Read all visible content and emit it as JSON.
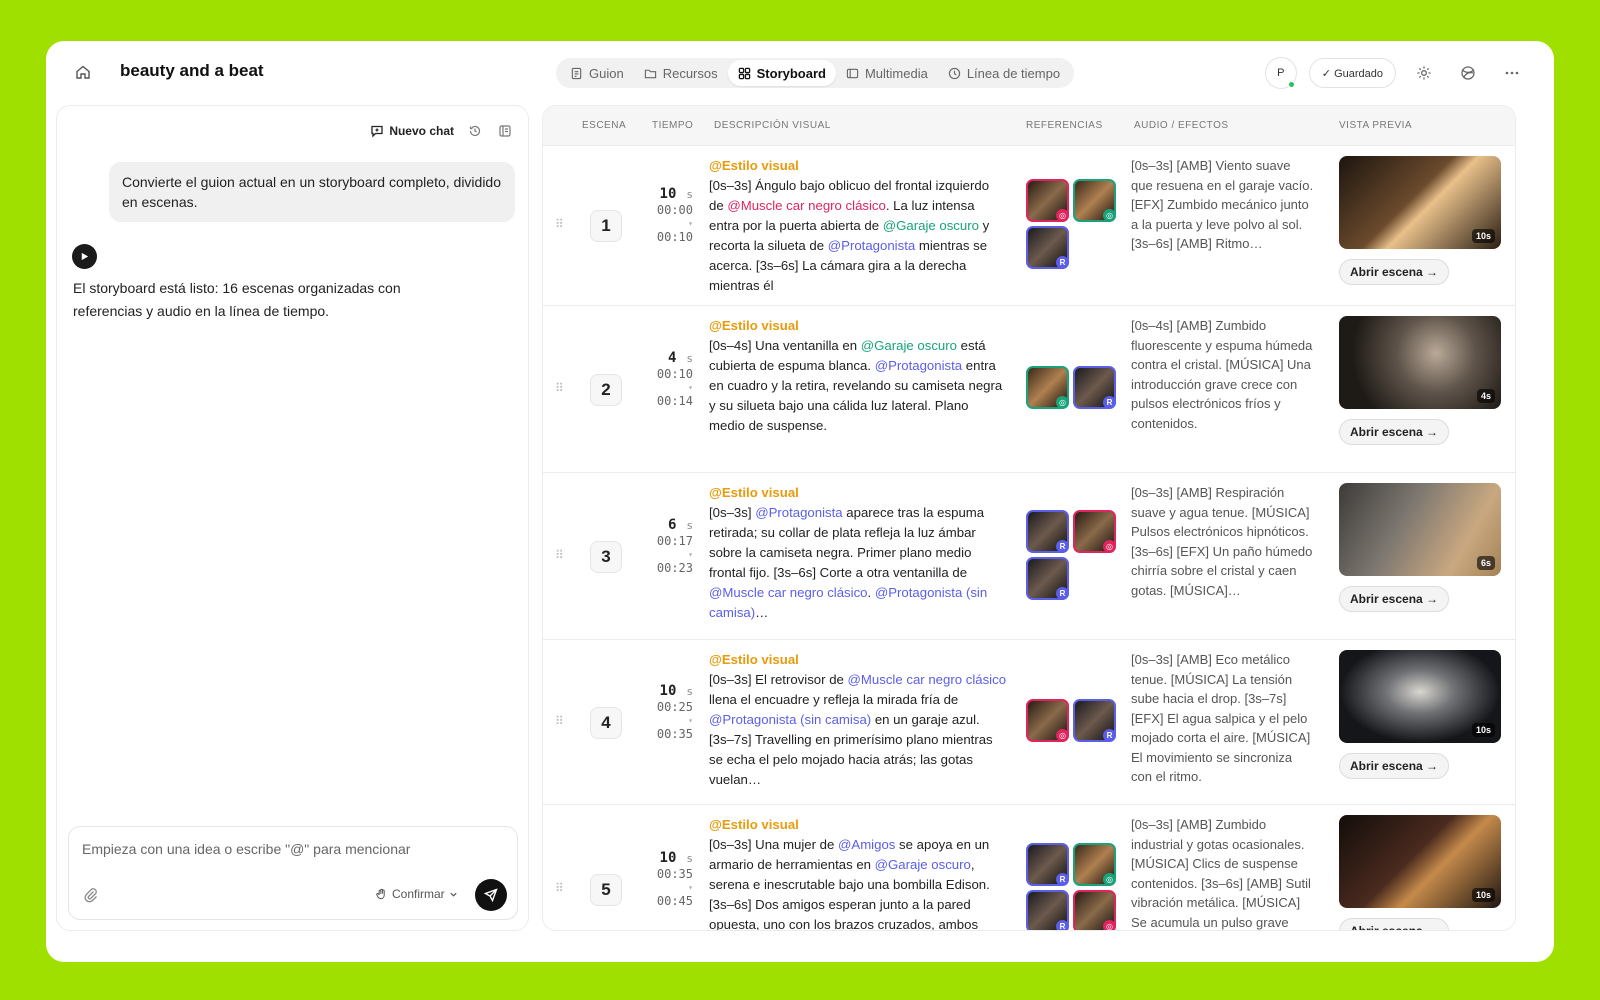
{
  "header": {
    "title": "beauty and a beat",
    "tabs": [
      {
        "label": "Guion",
        "icon": "script-icon"
      },
      {
        "label": "Recursos",
        "icon": "folder-icon"
      },
      {
        "label": "Storyboard",
        "icon": "grid-icon",
        "active": true
      },
      {
        "label": "Multimedia",
        "icon": "media-icon"
      },
      {
        "label": "Línea de tiempo",
        "icon": "clock-icon"
      }
    ],
    "avatar_initial": "P",
    "saved_label": "✓ Guardado"
  },
  "chat": {
    "new_chat_label": "Nuevo chat",
    "user_message": "Convierte el guion actual en un storyboard completo, dividido en escenas.",
    "ai_message": "El storyboard está listo: 16 escenas organizadas con referencias y audio en la línea de tiempo.",
    "composer_placeholder": "Empieza con una idea o escribe \"@\" para mencionar",
    "confirm_label": "Confirmar"
  },
  "table": {
    "columns": {
      "escena": "ESCENA",
      "tiempo": "TIEMPO",
      "descripcion": "DESCRIPCIÓN VISUAL",
      "referencias": "REFERENCIAS",
      "audio": "AUDIO / EFECTOS",
      "vista": "VISTA PREVIA"
    },
    "open_label": "Abrir escena →",
    "style_tag": "@Estilo visual",
    "scenes": [
      {
        "number": "1",
        "duration": "10",
        "unit": "s",
        "start": "00:00",
        "end": "00:10",
        "desc": [
          {
            "t": "[0s–3s] Ángulo bajo oblicuo del frontal izquierdo de "
          },
          {
            "t": "@Muscle car negro clásico",
            "c": "red"
          },
          {
            "t": ". La luz intensa entra por la puerta abierta de "
          },
          {
            "t": "@Garaje oscuro",
            "c": "green"
          },
          {
            "t": " y recorta la silueta de "
          },
          {
            "t": "@Protagonista",
            "c": "blue"
          },
          {
            "t": " mientras se acerca. [3s–6s] La cámara gira a la derecha mientras él"
          }
        ],
        "refs": [
          "red",
          "green",
          "blue"
        ],
        "audio": "[0s–3s] [AMB] Viento suave que resuena en el garaje vacío. [EFX] Zumbido mecánico junto a la puerta y leve polvo al sol. [3s–6s] [AMB] Ritmo…",
        "preview_dur": "10s"
      },
      {
        "number": "2",
        "duration": "4",
        "unit": "s",
        "start": "00:10",
        "end": "00:14",
        "desc": [
          {
            "t": "[0s–4s] Una ventanilla en "
          },
          {
            "t": "@Garaje oscuro",
            "c": "green"
          },
          {
            "t": " está cubierta de espuma blanca. "
          },
          {
            "t": "@Protagonista",
            "c": "blue"
          },
          {
            "t": " entra en cuadro y la retira, revelando su camiseta negra y su silueta bajo una cálida luz lateral. Plano medio de suspense."
          }
        ],
        "refs": [
          "green",
          "blue"
        ],
        "audio": "[0s–4s] [AMB] Zumbido fluorescente y espuma húmeda contra el cristal. [MÚSICA] Una introducción grave crece con pulsos electrónicos fríos y contenidos.",
        "preview_dur": "4s"
      },
      {
        "number": "3",
        "duration": "6",
        "unit": "s",
        "start": "00:17",
        "end": "00:23",
        "desc": [
          {
            "t": "[0s–3s] "
          },
          {
            "t": "@Protagonista",
            "c": "blue"
          },
          {
            "t": " aparece tras la espuma retirada; su collar de plata refleja la luz ámbar sobre la camiseta negra. Primer plano medio frontal fijo. [3s–6s] Corte a otra ventanilla de "
          },
          {
            "t": "@Muscle car negro clásico",
            "c": "blue"
          },
          {
            "t": ". "
          },
          {
            "t": "@Protagonista (sin camisa)",
            "c": "blue"
          },
          {
            "t": "…"
          }
        ],
        "refs": [
          "blue",
          "red",
          "blue"
        ],
        "audio": "[0s–3s] [AMB] Respiración suave y agua tenue. [MÚSICA] Pulsos electrónicos hipnóticos. [3s–6s] [EFX] Un paño húmedo chirría sobre el cristal y caen gotas. [MÚSICA]…",
        "preview_dur": "6s"
      },
      {
        "number": "4",
        "duration": "10",
        "unit": "s",
        "start": "00:25",
        "end": "00:35",
        "desc": [
          {
            "t": "[0s–3s] El retrovisor de "
          },
          {
            "t": "@Muscle car negro clásico",
            "c": "blue"
          },
          {
            "t": " llena el encuadre y refleja la mirada fría de "
          },
          {
            "t": "@Protagonista (sin camisa)",
            "c": "blue"
          },
          {
            "t": " en un garaje azul. [3s–7s] Travelling en primerísimo plano mientras se echa el pelo mojado hacia atrás; las gotas vuelan…"
          }
        ],
        "refs": [
          "red",
          "blue"
        ],
        "audio": "[0s–3s] [AMB] Eco metálico tenue. [MÚSICA] La tensión sube hacia el drop. [3s–7s] [EFX] El agua salpica y el pelo mojado corta el aire. [MÚSICA] El movimiento se sincroniza con el ritmo.",
        "preview_dur": "10s"
      },
      {
        "number": "5",
        "duration": "10",
        "unit": "s",
        "start": "00:35",
        "end": "00:45",
        "desc": [
          {
            "t": "[0s–3s] Una mujer de "
          },
          {
            "t": "@Amigos",
            "c": "blue"
          },
          {
            "t": " se apoya en un armario de herramientas en "
          },
          {
            "t": "@Garaje oscuro",
            "c": "blue"
          },
          {
            "t": ", serena e inescrutable bajo una bombilla Edison. [3s–6s] Dos amigos esperan junto a la pared opuesta, uno con los brazos cruzados, ambos mirando al frente bajo una luz ámbar…"
          }
        ],
        "refs": [
          "blue",
          "green",
          "blue",
          "red"
        ],
        "audio": "[0s–3s] [AMB] Zumbido industrial y gotas ocasionales. [MÚSICA] Clics de suspense contenidos. [3s–6s] [AMB] Sutil vibración metálica. [MÚSICA] Se acumula un pulso grave oculto…",
        "preview_dur": "10s"
      }
    ]
  }
}
